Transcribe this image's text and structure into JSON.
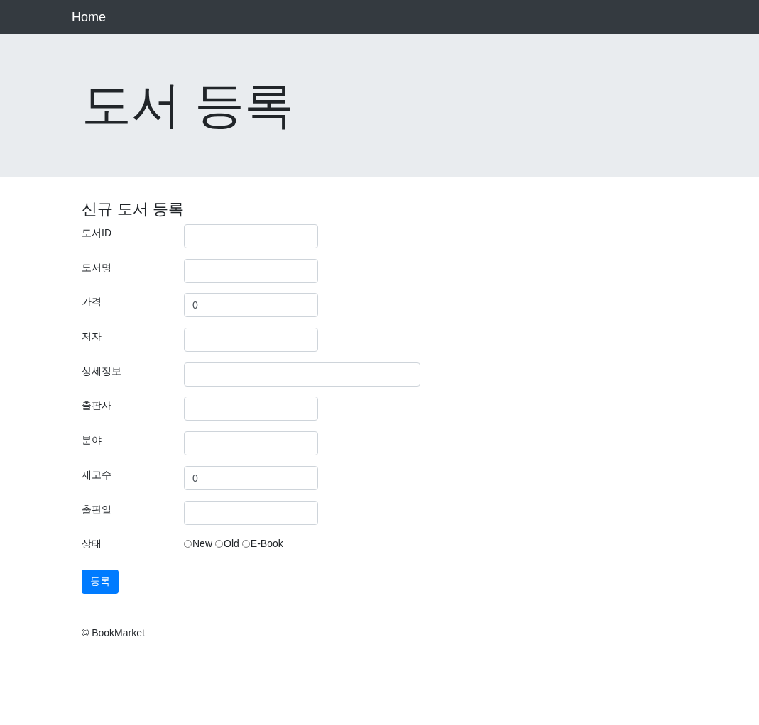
{
  "navbar": {
    "brand": "Home"
  },
  "jumbotron": {
    "title": "도서 등록"
  },
  "form": {
    "heading": "신규 도서 등록",
    "fields": [
      {
        "kind": "text",
        "label": "도서ID"
      },
      {
        "kind": "text",
        "label": "도서명"
      },
      {
        "kind": "text",
        "label": "가격",
        "value": "0"
      },
      {
        "kind": "text",
        "label": "저자"
      },
      {
        "kind": "long",
        "label": "상세정보"
      },
      {
        "kind": "text",
        "label": "출판사"
      },
      {
        "kind": "text",
        "label": "분야"
      },
      {
        "kind": "text",
        "label": "재고수",
        "value": "0"
      },
      {
        "kind": "text",
        "label": "출판일"
      },
      {
        "kind": "radio",
        "label": "상태",
        "options": [
          {
            "label": "New",
            "selected": false
          },
          {
            "label": "Old",
            "selected": false
          },
          {
            "label": "E-Book",
            "selected": false
          }
        ]
      }
    ],
    "submit": "등록"
  },
  "footer": {
    "text": "© BookMarket"
  }
}
